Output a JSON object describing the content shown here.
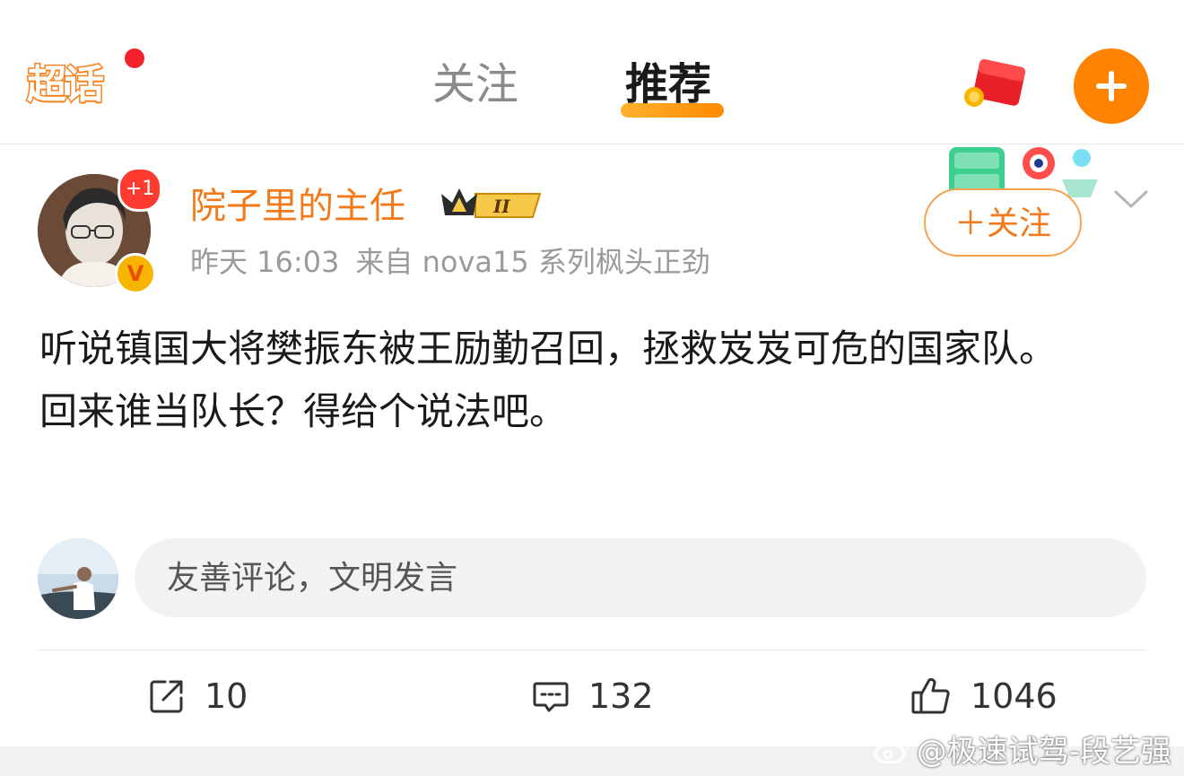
{
  "header": {
    "logo_text": "超话",
    "tabs": [
      {
        "label": "关注",
        "active": false
      },
      {
        "label": "推荐",
        "active": true
      }
    ],
    "accent_color": "#ff8200"
  },
  "post": {
    "author": {
      "name": "院子里的主任",
      "notification_badge": "+1",
      "verified_badge": "V",
      "level_badge": "II"
    },
    "meta": {
      "time": "昨天 16:03",
      "source": "来自 nova15 系列枫头正劲"
    },
    "follow_button_label": "＋关注",
    "content_lines": [
      "听说镇国大将樊振东被王励勤召回，拯救岌岌可危的国家队。",
      "回来谁当队长？得给个说法吧。"
    ]
  },
  "comment_box": {
    "placeholder": "友善评论，文明发言"
  },
  "actions": {
    "repost_count": "10",
    "comment_count": "132",
    "like_count": "1046"
  },
  "watermark": {
    "text": "@极速试驾-段艺强"
  }
}
